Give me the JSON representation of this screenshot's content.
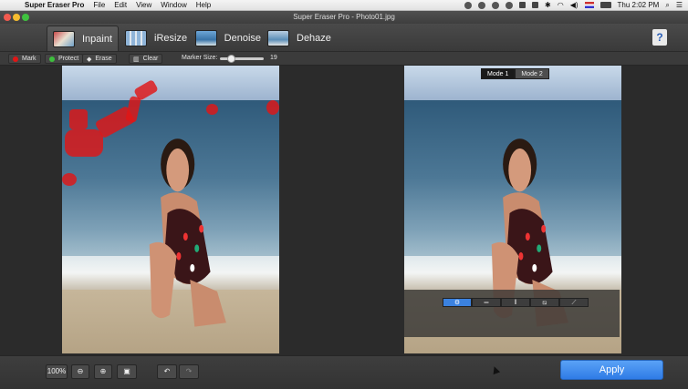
{
  "menubar": {
    "app_name": "Super Eraser Pro",
    "menus": [
      "File",
      "Edit",
      "View",
      "Window",
      "Help"
    ],
    "clock": "Thu 2:02 PM"
  },
  "window": {
    "title": "Super Eraser Pro - Photo01.jpg"
  },
  "tabs": [
    {
      "label": "Inpaint"
    },
    {
      "label": "iResize"
    },
    {
      "label": "Denoise"
    },
    {
      "label": "Dehaze"
    }
  ],
  "help_label": "?",
  "tools": {
    "mark": "Mark",
    "protect": "Protect",
    "erase": "Erase",
    "clear": "Clear",
    "marker_size_label": "Marker Size:",
    "marker_size_value": "19"
  },
  "preview": {
    "modes": [
      "Mode 1",
      "Mode 2"
    ],
    "split_icons": [
      "gear-icon",
      "split-horizontal-icon",
      "split-vertical-icon",
      "split-diagonal-left-icon",
      "split-diagonal-right-icon"
    ]
  },
  "bottom": {
    "zoom": "100%",
    "apply": "Apply"
  },
  "colors": {
    "accent": "#3b82e0",
    "mark": "#e01616",
    "protect": "#3dbf3d"
  }
}
